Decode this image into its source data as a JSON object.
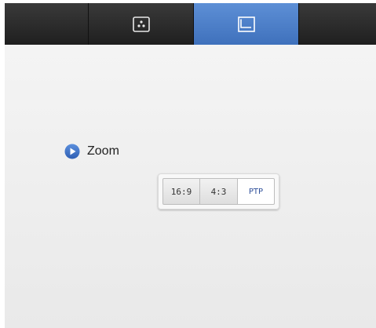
{
  "tabs": [
    {
      "icon": "blank",
      "selected": false
    },
    {
      "icon": "three-dots-icon",
      "selected": false
    },
    {
      "icon": "picture-frame-icon",
      "selected": true
    },
    {
      "icon": "blank",
      "selected": false
    }
  ],
  "zoom": {
    "label": "Zoom",
    "options": [
      "16:9",
      "4:3",
      "PTP"
    ],
    "selected": "PTP"
  },
  "colors": {
    "tab_selected": "#4a7cc7",
    "tab_bar": "#2a2a2a",
    "accent_icon": "#3b6fc2",
    "background": "#ececec"
  }
}
